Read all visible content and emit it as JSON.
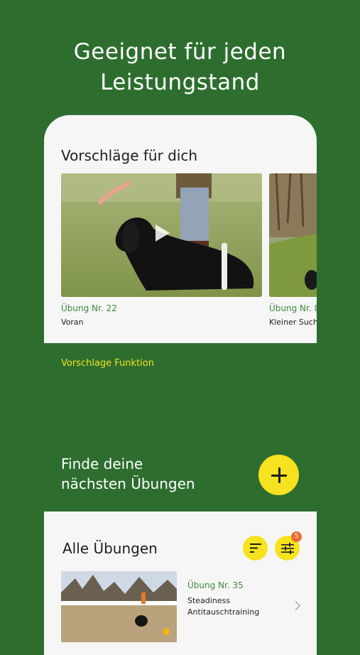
{
  "headline": {
    "line1": "Geeignet für jeden",
    "line2": "Leistungstand"
  },
  "suggestions": {
    "title": "Vorschläge für dich",
    "cards": [
      {
        "number": "Übung Nr. 22",
        "name": "Voran"
      },
      {
        "number": "Übung Nr. 8",
        "name": "Kleiner Such"
      }
    ]
  },
  "feature": {
    "label": "Vorschlage Funktion",
    "cta_line1": "Finde deine",
    "cta_line2": "nächsten Übungen"
  },
  "all_exercises": {
    "title": "Alle Übungen",
    "filter_badge": "5",
    "items": [
      {
        "number": "Übung Nr. 35",
        "name_line1": "Steadiness",
        "name_line2": "Antitauschtraining"
      }
    ]
  },
  "colors": {
    "brand_green": "#2d6e2f",
    "accent_yellow": "#f6e21e",
    "label_green": "#3f8a3e",
    "badge_orange": "#ef6b2e"
  }
}
